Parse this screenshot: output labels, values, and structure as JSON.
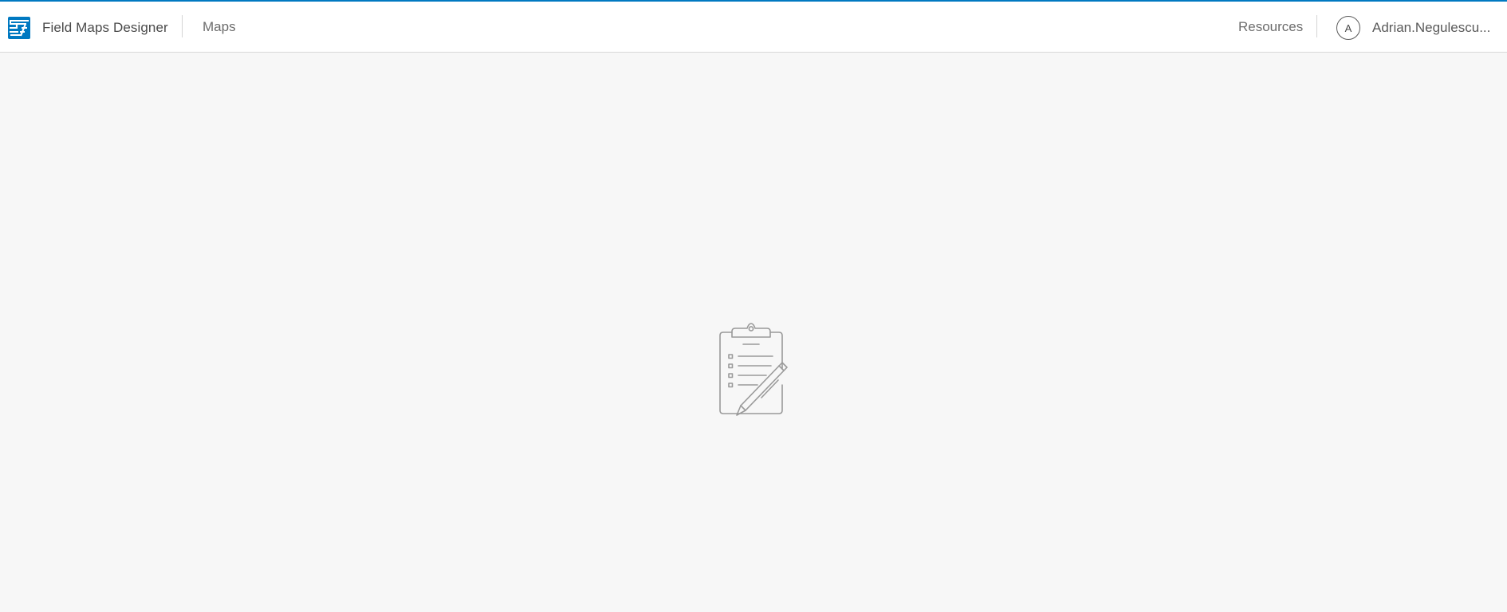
{
  "app": {
    "title": "Field Maps Designer",
    "logo_icon": "field-maps-logo-icon",
    "accent_color": "#0079c1"
  },
  "nav": {
    "maps_label": "Maps",
    "resources_label": "Resources"
  },
  "user": {
    "initial": "A",
    "name": "Adrian.Negulescu..."
  },
  "main": {
    "illustration_icon": "clipboard-pencil-icon"
  }
}
